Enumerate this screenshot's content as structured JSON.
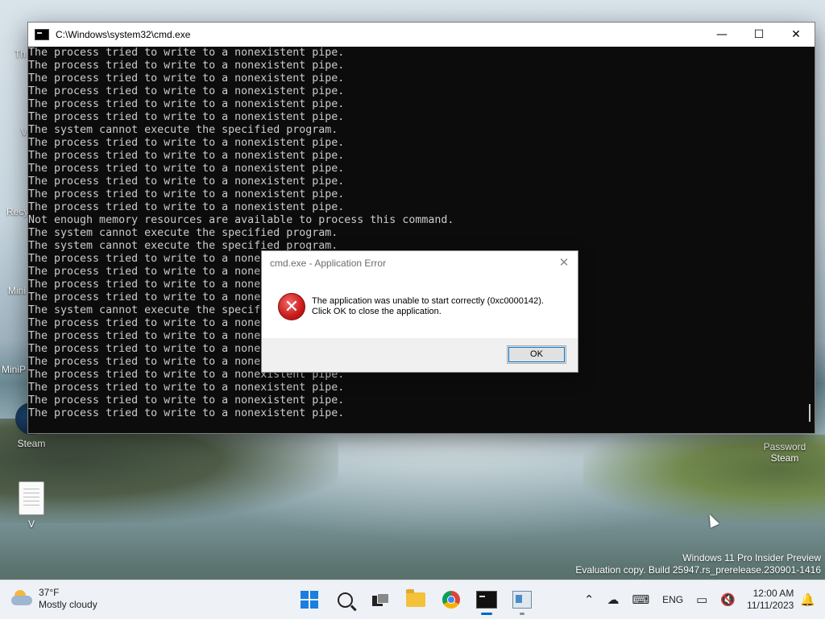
{
  "desktop": {
    "icons": [
      {
        "label": "Steam"
      },
      {
        "label": "V"
      }
    ],
    "partial_labels": [
      "Th",
      "V",
      "Recy",
      "Mini",
      "MiniP"
    ],
    "right_icon": {
      "label_line1": "Password",
      "label_line2": "Steam"
    },
    "watermark": {
      "line1": "Windows 11 Pro Insider Preview",
      "line2": "Evaluation copy. Build 25947.rs_prerelease.230901-1416"
    }
  },
  "cmd_window": {
    "title": "C:\\Windows\\system32\\cmd.exe",
    "controls": {
      "minimize": "—",
      "maximize": "☐",
      "close": "✕"
    },
    "lines": [
      "The process tried to write to a nonexistent pipe.",
      "The process tried to write to a nonexistent pipe.",
      "The process tried to write to a nonexistent pipe.",
      "The process tried to write to a nonexistent pipe.",
      "The process tried to write to a nonexistent pipe.",
      "The process tried to write to a nonexistent pipe.",
      "The system cannot execute the specified program.",
      "The process tried to write to a nonexistent pipe.",
      "The process tried to write to a nonexistent pipe.",
      "The process tried to write to a nonexistent pipe.",
      "The process tried to write to a nonexistent pipe.",
      "The process tried to write to a nonexistent pipe.",
      "The process tried to write to a nonexistent pipe.",
      "Not enough memory resources are available to process this command.",
      "The system cannot execute the specified program.",
      "The system cannot execute the specified program.",
      "The process tried to write to a nonexistent pipe.",
      "The process tried to write to a nonexistent pipe.",
      "The process tried to write to a nonexistent pipe.",
      "The process tried to write to a nonexistent pipe.",
      "The system cannot execute the specified program.",
      "The process tried to write to a nonexistent pipe.",
      "The process tried to write to a nonexistent pipe.",
      "The process tried to write to a nonexistent pipe.",
      "The process tried to write to a nonexistent pipe.",
      "The process tried to write to a nonexistent pipe.",
      "The process tried to write to a nonexistent pipe.",
      "The process tried to write to a nonexistent pipe.",
      "The process tried to write to a nonexistent pipe."
    ]
  },
  "dialog": {
    "title": "cmd.exe - Application Error",
    "close": "✕",
    "icon": "error-icon",
    "message_line1": "The application was unable to start correctly (0xc0000142).",
    "message_line2": "Click OK to close the application.",
    "ok_label": "OK"
  },
  "taskbar": {
    "weather": {
      "temp": "37°F",
      "condition": "Mostly cloudy"
    },
    "apps": [
      "start-icon",
      "search-icon",
      "task-view-icon",
      "file-explorer-icon",
      "chrome-icon",
      "cmd-icon",
      "registry-editor-icon"
    ],
    "tray": {
      "language": "ENG",
      "time": "12:00 AM",
      "date": "11/11/2023"
    }
  },
  "colors": {
    "console_bg": "#0c0c0c",
    "console_text": "#cccccc",
    "accent": "#0078d4",
    "error_red": "#c81a1a"
  }
}
